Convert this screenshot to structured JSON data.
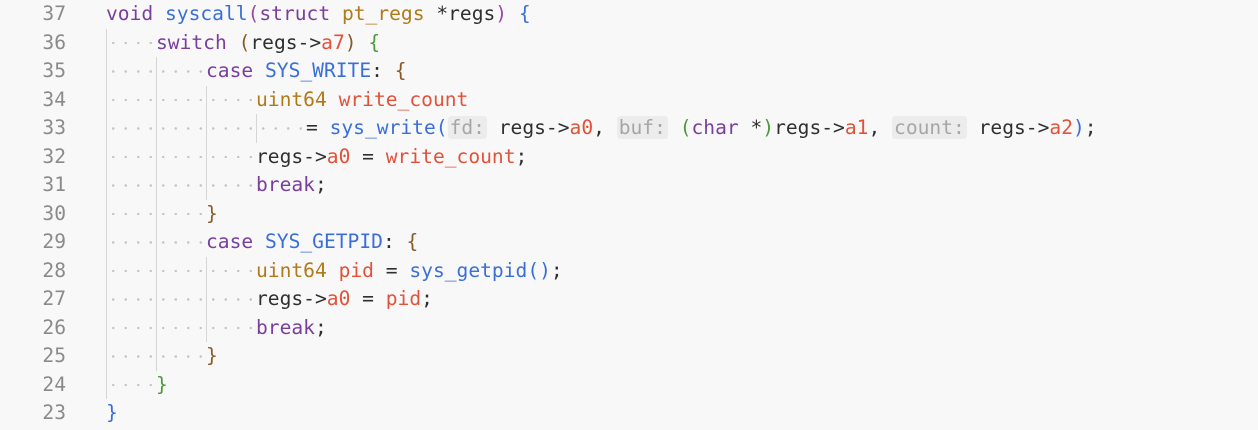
{
  "editor": {
    "lines": [
      {
        "num": "37",
        "indent": 0,
        "tokens": [
          {
            "t": "void",
            "c": "kw"
          },
          {
            "t": " "
          },
          {
            "t": "syscall",
            "c": "fn"
          },
          {
            "t": "(",
            "c": "b4"
          },
          {
            "t": "struct",
            "c": "kw"
          },
          {
            "t": " "
          },
          {
            "t": "pt_regs",
            "c": "ty"
          },
          {
            "t": " "
          },
          {
            "t": "*",
            "c": "pn"
          },
          {
            "t": "regs",
            "c": "pn"
          },
          {
            "t": ")",
            "c": "b4"
          },
          {
            "t": " "
          },
          {
            "t": "{",
            "c": "b1"
          }
        ]
      },
      {
        "num": "36",
        "indent": 1,
        "tokens": [
          {
            "t": "switch",
            "c": "kw"
          },
          {
            "t": " "
          },
          {
            "t": "(",
            "c": "b3"
          },
          {
            "t": "regs->",
            "c": "pn"
          },
          {
            "t": "a7",
            "c": "fd"
          },
          {
            "t": ")",
            "c": "b3"
          },
          {
            "t": " "
          },
          {
            "t": "{",
            "c": "b2"
          }
        ]
      },
      {
        "num": "35",
        "indent": 2,
        "tokens": [
          {
            "t": "case",
            "c": "kw"
          },
          {
            "t": " "
          },
          {
            "t": "SYS_WRITE",
            "c": "fn"
          },
          {
            "t": ": "
          },
          {
            "t": "{",
            "c": "b3"
          }
        ]
      },
      {
        "num": "34",
        "indent": 3,
        "tokens": [
          {
            "t": "uint64",
            "c": "ty"
          },
          {
            "t": " "
          },
          {
            "t": "write_count",
            "c": "pm"
          }
        ]
      },
      {
        "num": "33",
        "indent": 4,
        "tokens": [
          {
            "t": "= "
          },
          {
            "t": "sys_write",
            "c": "fn"
          },
          {
            "t": "(",
            "c": "b1"
          },
          {
            "t": "fd:",
            "c": "hint"
          },
          {
            "t": " regs->"
          },
          {
            "t": "a0",
            "c": "fd"
          },
          {
            "t": ", "
          },
          {
            "t": "buf:",
            "c": "hint"
          },
          {
            "t": " "
          },
          {
            "t": "(",
            "c": "b2"
          },
          {
            "t": "char",
            "c": "kw"
          },
          {
            "t": " "
          },
          {
            "t": "*",
            "c": "pn"
          },
          {
            "t": ")",
            "c": "b2"
          },
          {
            "t": "regs->"
          },
          {
            "t": "a1",
            "c": "fd"
          },
          {
            "t": ", "
          },
          {
            "t": "count:",
            "c": "hint"
          },
          {
            "t": " regs->"
          },
          {
            "t": "a2",
            "c": "fd"
          },
          {
            "t": ")",
            "c": "b1"
          },
          {
            "t": ";"
          }
        ]
      },
      {
        "num": "32",
        "indent": 3,
        "tokens": [
          {
            "t": "regs->"
          },
          {
            "t": "a0",
            "c": "fd"
          },
          {
            "t": " = "
          },
          {
            "t": "write_count",
            "c": "pm"
          },
          {
            "t": ";"
          }
        ]
      },
      {
        "num": "31",
        "indent": 3,
        "tokens": [
          {
            "t": "break",
            "c": "kw"
          },
          {
            "t": ";"
          }
        ]
      },
      {
        "num": "30",
        "indent": 2,
        "tokens": [
          {
            "t": "}",
            "c": "b3"
          }
        ]
      },
      {
        "num": "29",
        "indent": 2,
        "tokens": [
          {
            "t": "case",
            "c": "kw"
          },
          {
            "t": " "
          },
          {
            "t": "SYS_GETPID",
            "c": "fn"
          },
          {
            "t": ": "
          },
          {
            "t": "{",
            "c": "b3"
          }
        ]
      },
      {
        "num": "28",
        "indent": 3,
        "tokens": [
          {
            "t": "uint64",
            "c": "ty"
          },
          {
            "t": " "
          },
          {
            "t": "pid",
            "c": "pm"
          },
          {
            "t": " = "
          },
          {
            "t": "sys_getpid",
            "c": "fn"
          },
          {
            "t": "()",
            "c": "b1"
          },
          {
            "t": ";"
          }
        ]
      },
      {
        "num": "27",
        "indent": 3,
        "tokens": [
          {
            "t": "regs->"
          },
          {
            "t": "a0",
            "c": "fd"
          },
          {
            "t": " = "
          },
          {
            "t": "pid",
            "c": "pm"
          },
          {
            "t": ";"
          }
        ]
      },
      {
        "num": "26",
        "indent": 3,
        "tokens": [
          {
            "t": "break",
            "c": "kw"
          },
          {
            "t": ";"
          }
        ]
      },
      {
        "num": "25",
        "indent": 2,
        "tokens": [
          {
            "t": "}",
            "c": "b3"
          }
        ]
      },
      {
        "num": "24",
        "indent": 1,
        "tokens": [
          {
            "t": "}",
            "c": "b2"
          }
        ]
      },
      {
        "num": "23",
        "indent": 0,
        "tokens": [
          {
            "t": "}",
            "c": "b1"
          }
        ]
      }
    ]
  },
  "colors": {
    "background": "#f8f8f8",
    "keyword": "#7a3e9d",
    "type": "#b07a1a",
    "function": "#3a6fd8",
    "variable": "#e0533a",
    "line_number": "#8a8a8a",
    "inlay_hint_bg": "#ececec"
  }
}
